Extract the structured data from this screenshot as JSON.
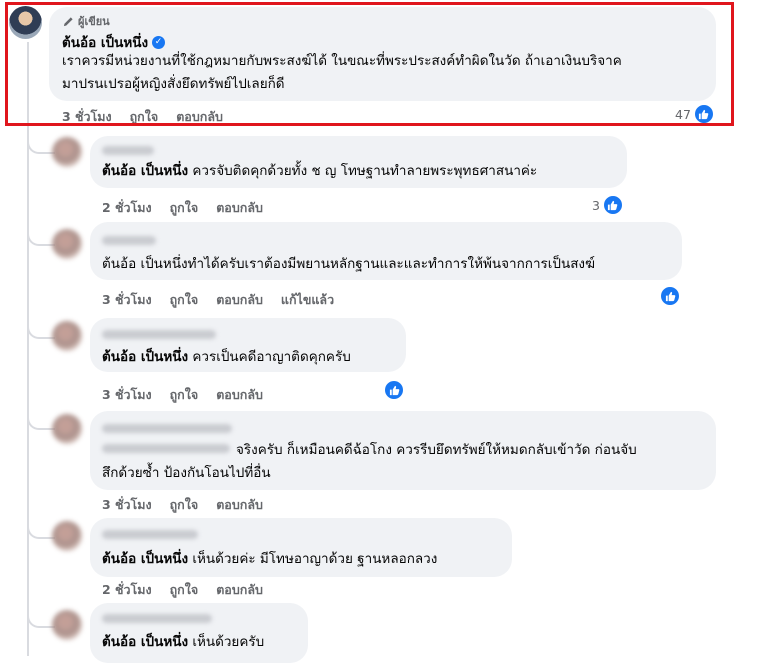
{
  "main_comment": {
    "badge": "ผู้เขียน",
    "author": "ต้นอ้อ เป็นหนึ่ง",
    "text_line1": "เราควรมีหน่วยงานที่ใช้กฎหมายกับพระสงฆ์ได้ ในขณะที่พระประสงค์ทำผิดในวัด ถ้าเอาเงินบริจาค",
    "text_line2": "มาปรนเปรอผู้หญิงสั่งยึดทรัพย์ไปเลยก็ดี",
    "time": "3 ชั่วโมง",
    "like_label": "ถูกใจ",
    "reply_label": "ตอบกลับ",
    "reaction_count": "47"
  },
  "replies": [
    {
      "mention": "ต้นอ้อ เป็นหนึ่ง",
      "text": " ควรจับติดคุกด้วยทั้ง ช ญ โทษฐานทำลายพระพุทธศาสนาค่ะ",
      "time": "2 ชั่วโมง",
      "like_label": "ถูกใจ",
      "reply_label": "ตอบกลับ",
      "reaction_count": "3"
    },
    {
      "mention": "",
      "text": "ต้นอ้อ เป็นหนึ่งทำได้ครับเราต้องมีพยานหลักฐานและและทำการให้พ้นจากการเป็นสงฆ์",
      "time": "3 ชั่วโมง",
      "like_label": "ถูกใจ",
      "reply_label": "ตอบกลับ",
      "edited_label": "แก้ไขแล้ว"
    },
    {
      "mention": "ต้นอ้อ เป็นหนึ่ง",
      "text": " ควรเป็นคดีอาญาติดคุกครับ",
      "time": "3 ชั่วโมง",
      "like_label": "ถูกใจ",
      "reply_label": "ตอบกลับ"
    },
    {
      "text_line1": "จริงครับ ก็เหมือนคดีฉ้อโกง ควรรีบยึดทรัพย์ให้หมดกลับเข้าวัด ก่อนจับ",
      "text_line2": "สึกด้วยซ้ำ ป้องกันโอนไปที่อื่น",
      "time": "3 ชั่วโมง",
      "like_label": "ถูกใจ",
      "reply_label": "ตอบกลับ"
    },
    {
      "mention": "ต้นอ้อ เป็นหนึ่ง",
      "text": " เห็นด้วยค่ะ มีโทษอาญาด้วย ฐานหลอกลวง",
      "time": "2 ชั่วโมง",
      "like_label": "ถูกใจ",
      "reply_label": "ตอบกลับ"
    },
    {
      "mention": "ต้นอ้อ เป็นหนึ่ง",
      "text": " เห็นด้วยครับ"
    }
  ],
  "colors": {
    "bubble": "#f0f2f5",
    "accent": "#1877f2",
    "meta": "#65676b",
    "highlight": "#e0161d"
  }
}
